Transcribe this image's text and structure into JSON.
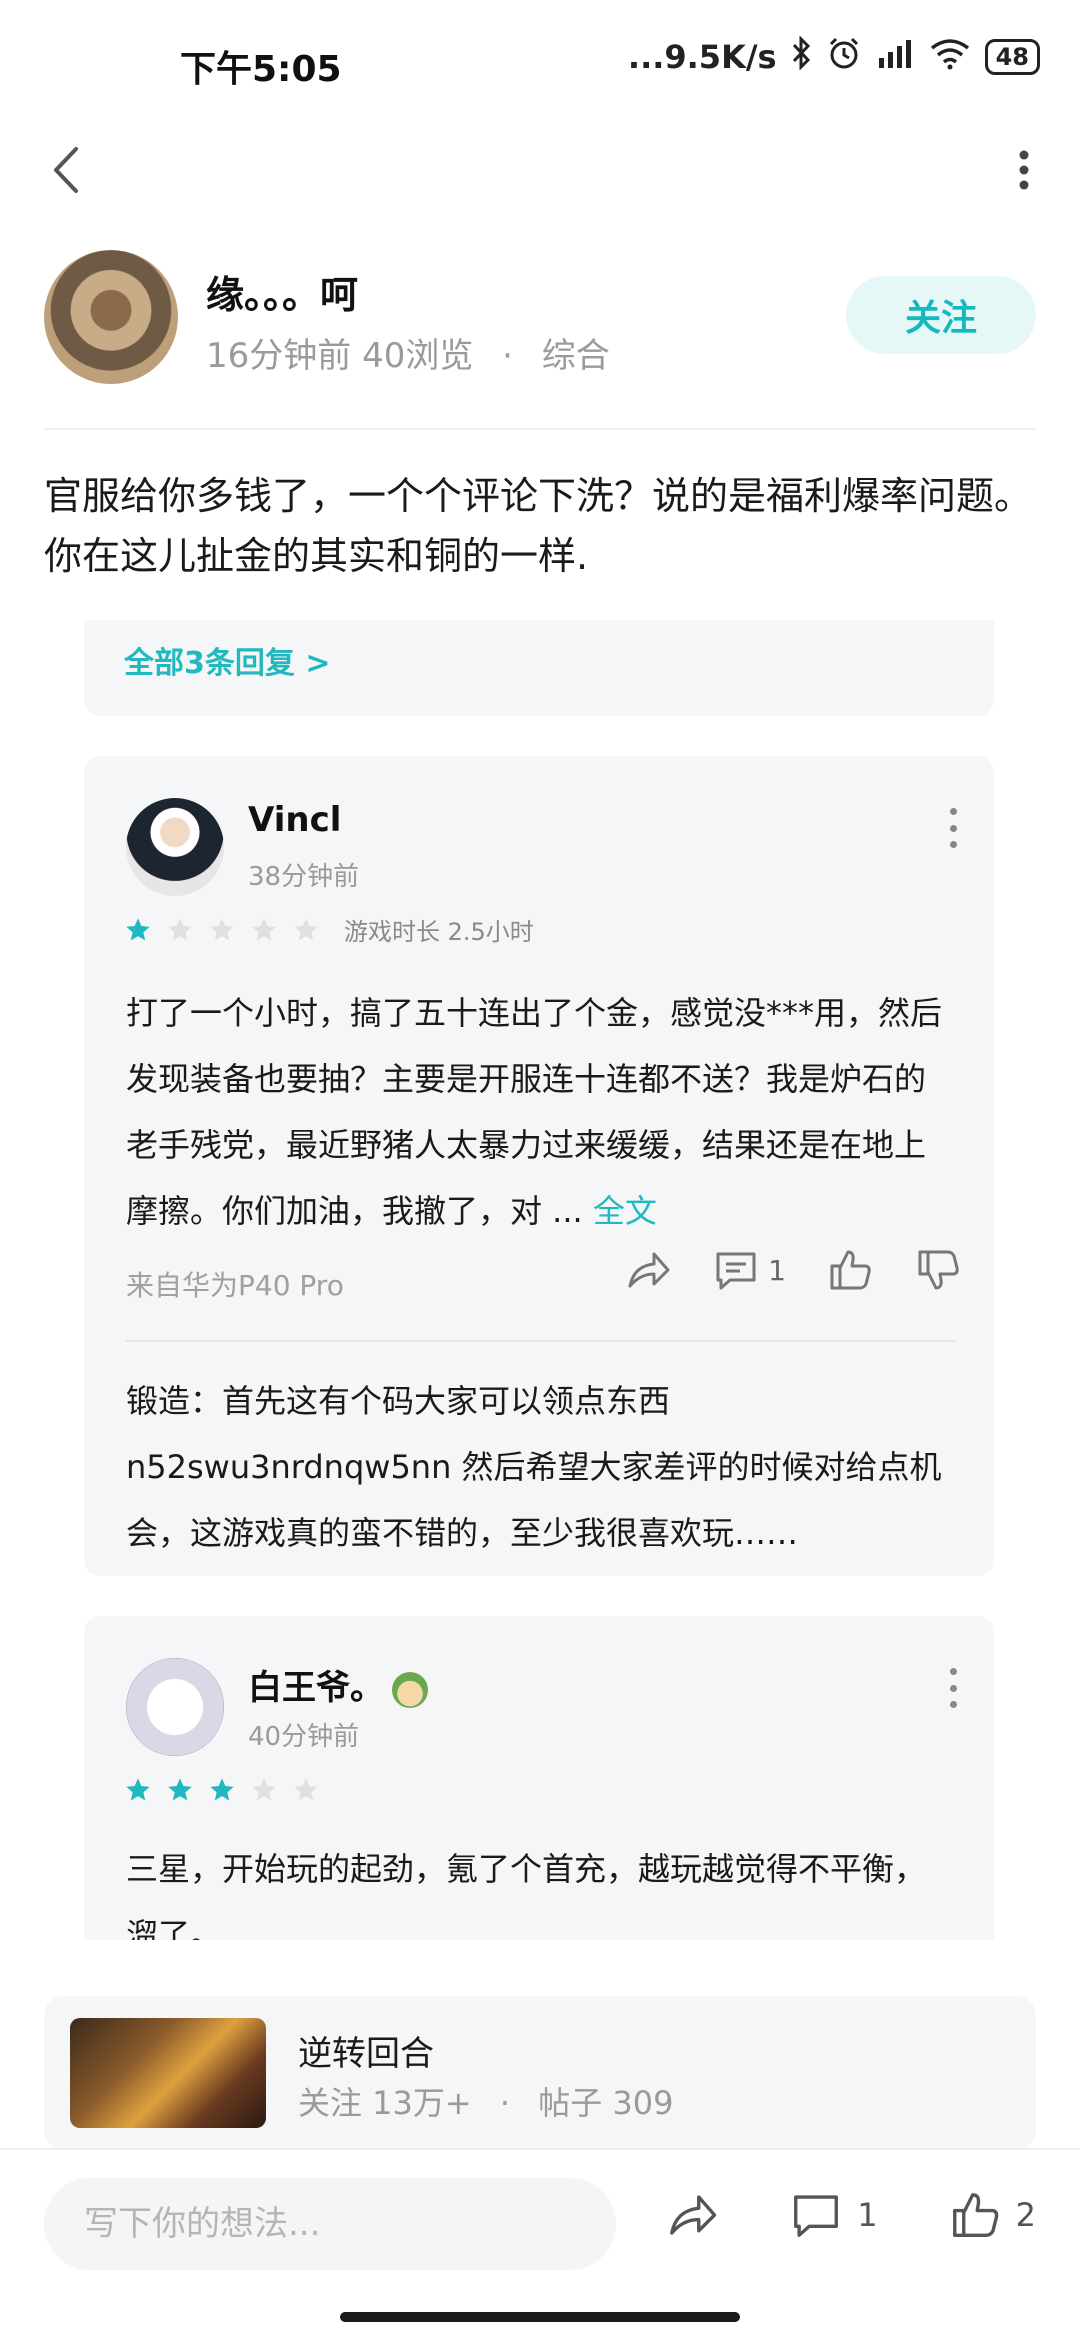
{
  "status_bar": {
    "time": "下午5:05",
    "network_speed": "...9.5K/s",
    "battery": "48"
  },
  "post": {
    "author": {
      "name": "缘。。。呵",
      "time_ago": "16分钟前",
      "views": "40浏览",
      "separator": "·",
      "category": "综合"
    },
    "follow_label": "关注",
    "body": "官服给你多钱了，一个个评论下洗？说的是福利爆率问题。你在这儿扯金的其实和铜的一样."
  },
  "screenshot": {
    "all_replies_label": "全部3条回复 >",
    "reviews": [
      {
        "name": "Vincl",
        "time_ago": "38分钟前",
        "stars": 1,
        "playtime": "游戏时长 2.5小时",
        "text": "打了一个小时，搞了五十连出了个金，感觉没***用，然后发现装备也要抽？主要是开服连十连都不送？我是炉石的老手残党，最近野猪人太暴力过来缓缓，结果还是在地上摩擦。你们加油，我撤了，对 ...",
        "fulltext_label": "全文",
        "source": "来自华为P40 Pro",
        "comment_count": "1",
        "reply": "锻造：首先这有个码大家可以领点东西n52swu3nrdnqw5nn 然后希望大家差评的时候对给点机会，这游戏真的蛮不错的，至少我很喜欢玩……"
      },
      {
        "name": "白王爷。",
        "time_ago": "40分钟前",
        "stars": 3,
        "text": "三星，开始玩的起劲，氪了个首充，越玩越觉得不平衡，溜了。"
      }
    ]
  },
  "game": {
    "name": "逆转回合",
    "followers": "关注 13万+",
    "separator": "·",
    "posts": "帖子 309"
  },
  "bottom_bar": {
    "input_placeholder": "写下你的想法...",
    "comment_count": "1",
    "like_count": "2"
  },
  "colors": {
    "accent": "#22b8c0",
    "follow_bg": "#e6f7f7",
    "card_bg": "#f5f6f7",
    "star_active": "#22b8c0",
    "star_inactive": "#e0e0e0"
  }
}
